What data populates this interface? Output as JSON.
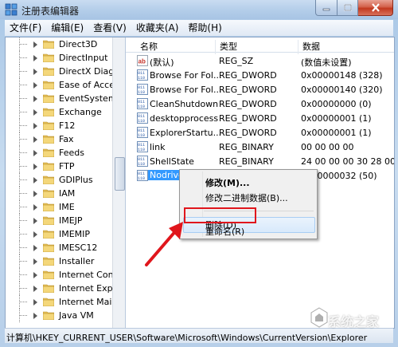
{
  "window": {
    "title": "注册表编辑器"
  },
  "menu": [
    "文件(F)",
    "编辑(E)",
    "查看(V)",
    "收藏夹(A)",
    "帮助(H)"
  ],
  "tree": [
    "Direct3D",
    "DirectInput",
    "DirectX Diagno",
    "Ease of Access",
    "EventSystem",
    "Exchange",
    "F12",
    "Fax",
    "Feeds",
    "FTP",
    "GDIPlus",
    "IAM",
    "IME",
    "IMEJP",
    "IMEMIP",
    "IMESC12",
    "Installer",
    "Internet Conne",
    "Internet Explo",
    "Internet Mail a",
    "Java VM"
  ],
  "columns": {
    "name": "名称",
    "type": "类型",
    "data": "数据"
  },
  "values": [
    {
      "icon": "string-value-icon",
      "name": "(默认)",
      "type": "REG_SZ",
      "data": "(数值未设置)"
    },
    {
      "icon": "binary-value-icon",
      "name": "Browse For Fol...",
      "type": "REG_DWORD",
      "data": "0x00000148 (328)"
    },
    {
      "icon": "binary-value-icon",
      "name": "Browse For Fol...",
      "type": "REG_DWORD",
      "data": "0x00000140 (320)"
    },
    {
      "icon": "binary-value-icon",
      "name": "CleanShutdown",
      "type": "REG_DWORD",
      "data": "0x00000000 (0)"
    },
    {
      "icon": "binary-value-icon",
      "name": "desktopprocess",
      "type": "REG_DWORD",
      "data": "0x00000001 (1)"
    },
    {
      "icon": "binary-value-icon",
      "name": "ExplorerStartu...",
      "type": "REG_DWORD",
      "data": "0x00000001 (1)"
    },
    {
      "icon": "binary-value-icon",
      "name": "link",
      "type": "REG_BINARY",
      "data": "00 00 00 00"
    },
    {
      "icon": "binary-value-icon",
      "name": "ShellState",
      "type": "REG_BINARY",
      "data": "24 00 00 00 30 28 00 00"
    },
    {
      "icon": "binary-value-icon",
      "name": "Nodrives",
      "type": "REG_DWORD",
      "data": "0x00000032 (50)",
      "selected": true
    }
  ],
  "context_menu": {
    "modify": "修改(M)...",
    "modify_binary": "修改二进制数据(B)...",
    "delete": "删除(D)",
    "rename": "重命名(R)"
  },
  "status": "计算机\\HKEY_CURRENT_USER\\Software\\Microsoft\\Windows\\CurrentVersion\\Explorer",
  "watermark": "系统之家",
  "colors": {
    "selection": "#3399ff",
    "highlight_box": "#e0161c",
    "close_button": "#c2391f"
  }
}
